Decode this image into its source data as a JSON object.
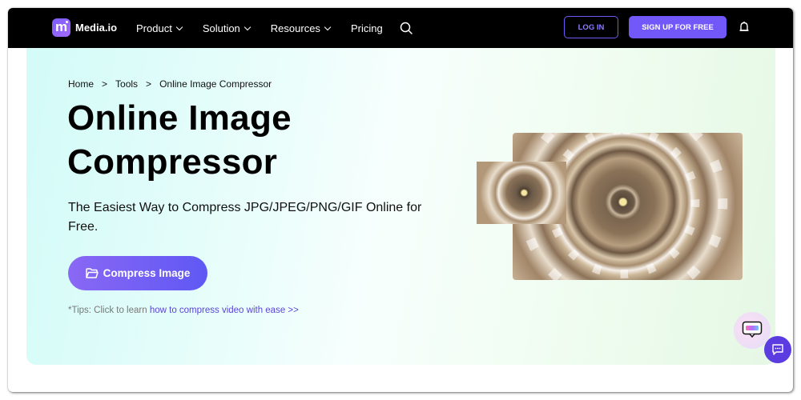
{
  "nav": {
    "logo_text": "Media.io",
    "logo_glyph": "m",
    "items": [
      {
        "label": "Product",
        "has_dropdown": true
      },
      {
        "label": "Solution",
        "has_dropdown": true
      },
      {
        "label": "Resources",
        "has_dropdown": true
      },
      {
        "label": "Pricing",
        "has_dropdown": false
      }
    ],
    "search_icon": "search-icon",
    "login_label": "LOG IN",
    "signup_label": "SIGN UP FOR FREE",
    "notification_icon": "bell-icon"
  },
  "hero": {
    "breadcrumb": [
      {
        "label": "Home"
      },
      {
        "label": "Tools"
      },
      {
        "label": "Online Image Compressor"
      }
    ],
    "breadcrumb_separator": ">",
    "title": "Online Image Compressor",
    "subtitle": "The Easiest Way to Compress JPG/JPEG/PNG/GIF Online for Free.",
    "cta_label": "Compress Image",
    "cta_icon": "folder-open-icon",
    "tips_prefix": "*Tips: Click to learn ",
    "tips_link": "how to compress video with ease >>",
    "illustration": "dome-ceiling-photo-before-after"
  },
  "floating": {
    "ai_assistant_icon": "ai-chat-icon",
    "chat_icon": "chat-bubble-icon"
  },
  "colors": {
    "nav_bg": "#000000",
    "accent": "#7258f8",
    "link": "#5b45d6",
    "chat_button": "#5b3ce0"
  }
}
